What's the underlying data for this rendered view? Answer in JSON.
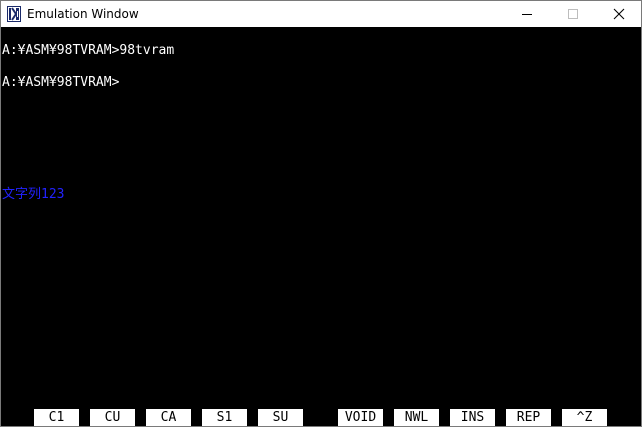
{
  "window": {
    "title": "Emulation Window"
  },
  "screen": {
    "lines": [
      "A:¥ASM¥98TVRAM>98tvram",
      "A:¥ASM¥98TVRAM>",
      "文字列123"
    ],
    "text_color": "#ffffff",
    "highlight_color": "#2222ff",
    "background": "#000000"
  },
  "function_keys": [
    "C1",
    "CU",
    "CA",
    "S1",
    "SU",
    "VOID",
    "NWL",
    "INS",
    "REP",
    "^Z"
  ]
}
